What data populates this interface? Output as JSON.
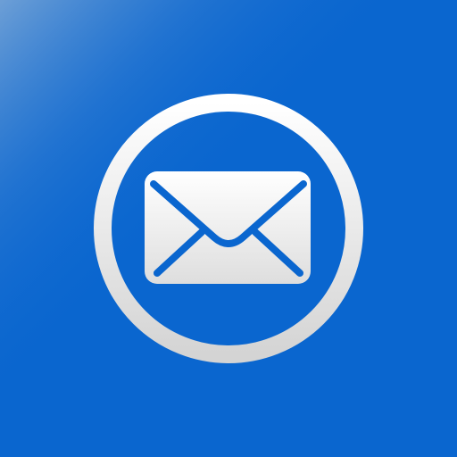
{
  "icon": {
    "name": "mail-icon",
    "colors": {
      "background": "#0a66cf",
      "background_highlight": "#5a93d2",
      "foreground": "#ffffff",
      "foreground_shade": "#d9d9d9"
    }
  }
}
